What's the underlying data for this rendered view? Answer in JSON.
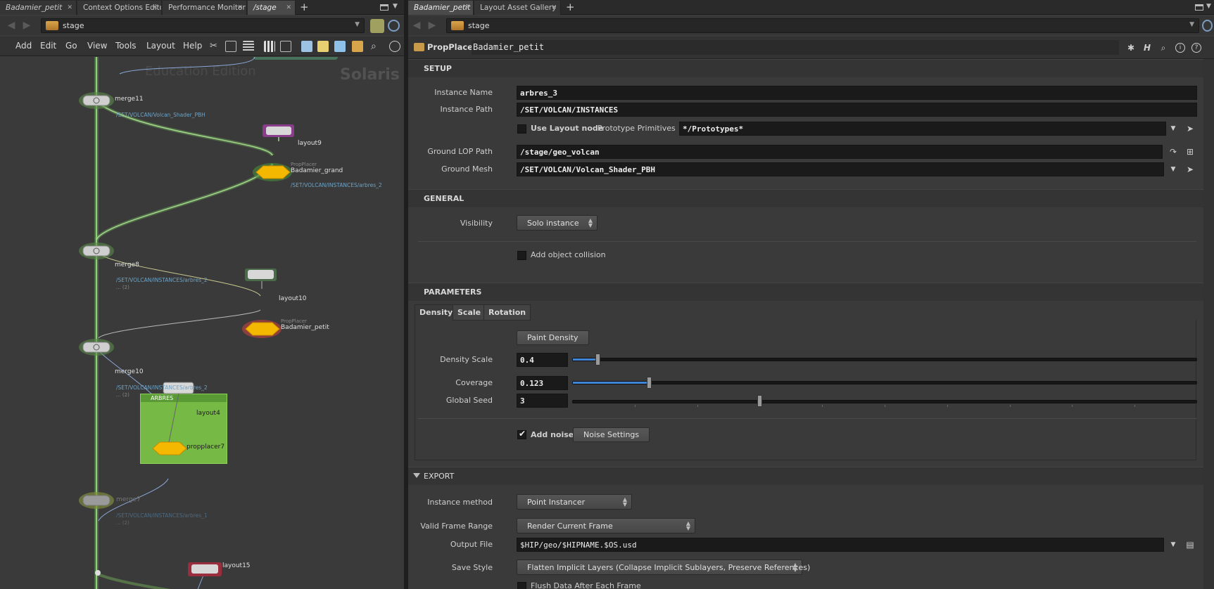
{
  "left_pane": {
    "tabs": [
      {
        "label": "Badamier_petit",
        "italic": true
      },
      {
        "label": "Context Options Editor",
        "italic": false
      },
      {
        "label": "Performance Monitor",
        "italic": false
      },
      {
        "label": "/stage",
        "italic": true,
        "active": true
      }
    ],
    "path": "stage",
    "menu": [
      "Add",
      "Edit",
      "Go",
      "View",
      "Tools",
      "Layout",
      "Help"
    ],
    "network": {
      "watermark_edition": "Education Edition",
      "watermark_context": "Solaris",
      "nodes": [
        {
          "name": "merge11",
          "path": "/SET/VOLCAN/Volcan_Shader_PBH"
        },
        {
          "name": "layout9"
        },
        {
          "type": "PropPlacer",
          "name": "Badamier_grand",
          "path": "/SET/VOLCAN/INSTANCES/arbres_2"
        },
        {
          "name": "merge8",
          "path": "/SET/VOLCAN/INSTANCES/arbres_2",
          "extra": "... (2)"
        },
        {
          "name": "layout10"
        },
        {
          "type": "PropPlacer",
          "name": "Badamier_petit"
        },
        {
          "name": "merge10",
          "path": "/SET/VOLCAN/INSTANCES/arbres_2",
          "extra": "... (2)"
        },
        {
          "name": "layout4"
        },
        {
          "name": "propplacer7"
        },
        {
          "name": "merge7",
          "path": "/SET/VOLCAN/INSTANCES/arbres_1",
          "extra": "... (2)"
        },
        {
          "name": "layout15"
        }
      ],
      "box_title": "ARBRES"
    }
  },
  "right_pane": {
    "tabs": [
      {
        "label": "Badamier_petit",
        "italic": true,
        "active": true
      },
      {
        "label": "Layout Asset Gallery",
        "italic": false
      }
    ],
    "path": "stage",
    "node_type": "PropPlacer",
    "node_name": "Badamier_petit",
    "sections": {
      "setup": {
        "title": "SETUP",
        "instance_name_label": "Instance Name",
        "instance_name": "arbres_3",
        "instance_path_label": "Instance Path",
        "instance_path": "/SET/VOLCAN/INSTANCES",
        "use_layout_node_label": "Use Layout node",
        "use_layout_node": false,
        "prototype_primitives_label": "Prototype Primitives",
        "prototype_primitives": "*/Prototypes*",
        "ground_lop_path_label": "Ground LOP Path",
        "ground_lop_path": "/stage/geo_volcan",
        "ground_mesh_label": "Ground Mesh",
        "ground_mesh": "/SET/VOLCAN/Volcan_Shader_PBH"
      },
      "general": {
        "title": "GENERAL",
        "visibility_label": "Visibility",
        "visibility": "Solo instance",
        "add_object_collision_label": "Add object collision",
        "add_object_collision": false
      },
      "parameters": {
        "title": "PARAMETERS",
        "tabs": [
          "Density",
          "Scale",
          "Rotation"
        ],
        "active_tab": "Density",
        "paint_density_label": "Paint Density",
        "density_scale_label": "Density Scale",
        "density_scale": "0.4",
        "density_scale_fraction": 0.04,
        "coverage_label": "Coverage",
        "coverage": "0.123",
        "coverage_fraction": 0.123,
        "global_seed_label": "Global Seed",
        "global_seed": "3",
        "global_seed_fraction": 0.3,
        "add_noise_label": "Add noise",
        "add_noise": true,
        "noise_settings_label": "Noise Settings"
      },
      "export": {
        "title": "EXPORT",
        "instance_method_label": "Instance method",
        "instance_method": "Point Instancer",
        "valid_frame_range_label": "Valid Frame Range",
        "valid_frame_range": "Render Current Frame",
        "output_file_label": "Output File",
        "output_file": "$HIP/geo/$HIPNAME.$OS.usd",
        "save_style_label": "Save Style",
        "save_style": "Flatten Implicit Layers (Collapse Implicit Sublayers, Preserve References)",
        "flush_data_label": "Flush Data After Each Frame"
      }
    }
  },
  "colors": {
    "accent_blue": "#3f86d8",
    "node_yellow": "#f5b800",
    "wire_green": "#7fc760",
    "network_box": "#76b944"
  }
}
